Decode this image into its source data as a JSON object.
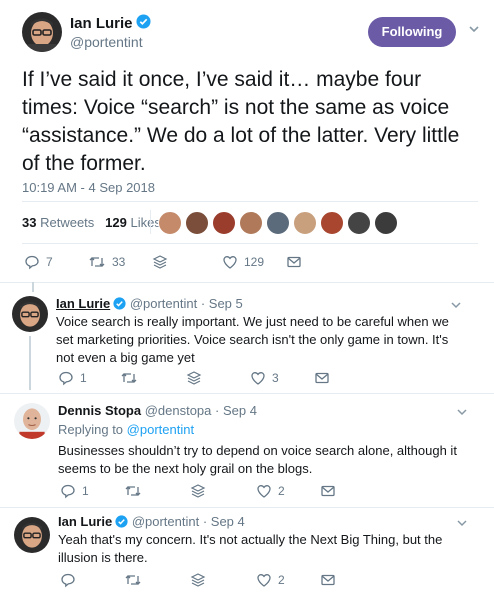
{
  "main_tweet": {
    "author_name": "Ian Lurie",
    "author_handle": "@portentint",
    "follow_label": "Following",
    "text": "If I’ve said it once, I’ve said it… maybe four times: Voice “search” is not the same as voice “assistance.” We do a lot of the latter. Very little of the former.",
    "timestamp": "10:19 AM - 4 Sep 2018",
    "retweets_count": "33",
    "retweets_label": "Retweets",
    "likes_count": "129",
    "likes_label": "Likes",
    "actions": {
      "replies": "7",
      "retweets": "33",
      "likes": "129"
    }
  },
  "replies": [
    {
      "author_name": "Ian Lurie",
      "author_handle": "@portentint",
      "date": "· Sep 5",
      "text": "Voice search is really important. We just need to be careful when we set marketing priorities. Voice search isn't the only game in town. It's not even a big game yet",
      "actions": {
        "replies": "1",
        "retweets": "",
        "likes": "3"
      }
    },
    {
      "author_name": "Dennis Stopa",
      "author_handle": "@denstopa",
      "date": "· Sep 4",
      "replying_prefix": "Replying to",
      "replying_to": "@portentint",
      "text": "Businesses shouldn’t try to depend on voice search alone, although it seems to be the next holy grail on the blogs.",
      "actions": {
        "replies": "1",
        "retweets": "",
        "likes": "2"
      }
    },
    {
      "author_name": "Ian Lurie",
      "author_handle": "@portentint",
      "date": "· Sep 4",
      "text": "Yeah that's my concern. It's not actually the Next Big Thing, but the illusion is there.",
      "actions": {
        "replies": "",
        "retweets": "",
        "likes": "2"
      }
    }
  ],
  "colors": {
    "follow_button": "#6b5ba6",
    "verified": "#1da1f2",
    "icon_gray": "#657786",
    "thread_line": "#ccd6dd"
  }
}
